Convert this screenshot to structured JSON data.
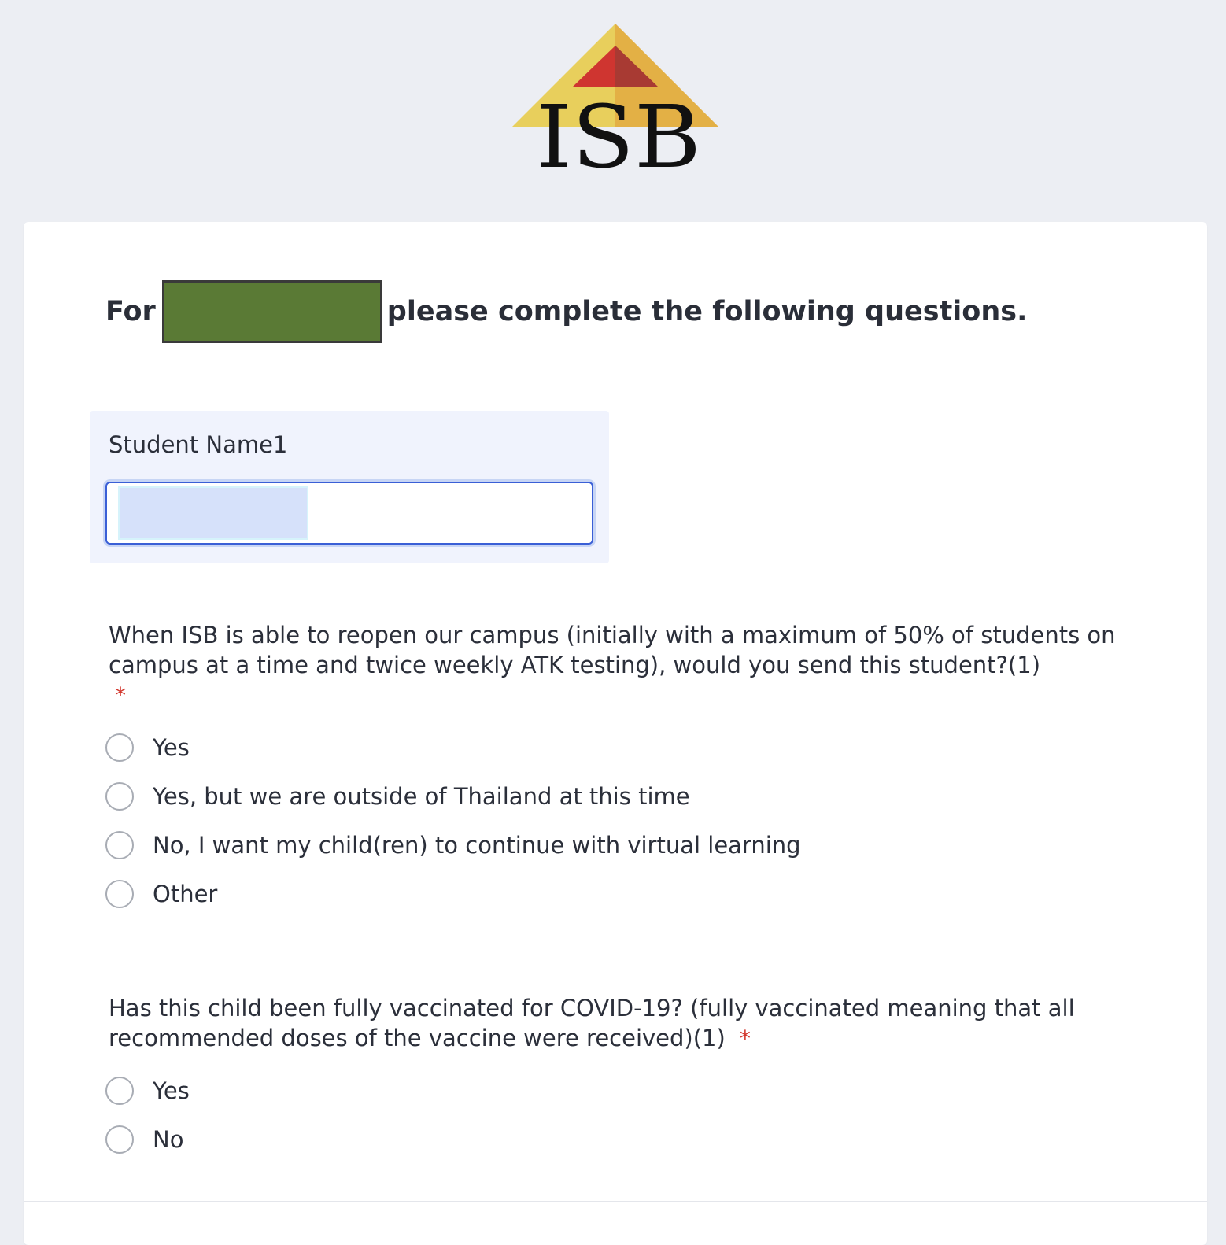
{
  "logo": {
    "text": "ISB",
    "colors": {
      "gold_left": "#e8cf5c",
      "gold_right": "#e3b045",
      "red_left": "#cf3530",
      "red_right": "#a83a33",
      "text": "#111111"
    }
  },
  "form": {
    "heading_prefix": "For",
    "heading_suffix": "please complete the following questions.",
    "student_name": {
      "label": "Student Name1",
      "value": ""
    },
    "questions": [
      {
        "text": "When ISB is able to reopen our campus (initially with a maximum of 50% of students on campus at a time and twice weekly ATK testing), would you send this student?(1)",
        "required_mark": "*",
        "options": [
          "Yes",
          "Yes, but we are outside of Thailand at this time",
          "No, I want my child(ren) to continue with virtual learning",
          "Other"
        ]
      },
      {
        "text": "Has this child been fully vaccinated for COVID-19? (fully vaccinated meaning that all recommended doses of the vaccine were received)(1)",
        "required_mark": "*",
        "options": [
          "Yes",
          "No"
        ]
      }
    ]
  }
}
